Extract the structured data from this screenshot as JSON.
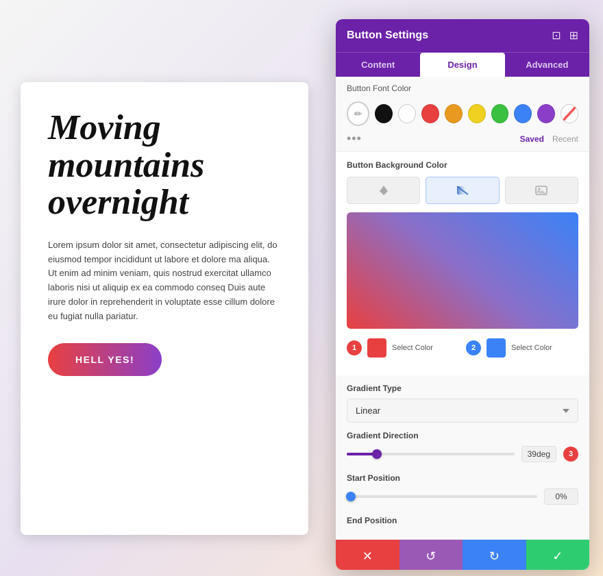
{
  "page": {
    "heading": "Moving mountains overnight",
    "body_text": "Lorem ipsum dolor sit amet, consectetur adipiscing elit, do eiusmod tempor incididunt ut labore et dolore ma aliqua. Ut enim ad minim veniam, quis nostrud exercitat ullamco laboris nisi ut aliquip ex ea commodo conseq Duis aute irure dolor in reprehenderit in voluptate esse cillum dolore eu fugiat nulla pariatur.",
    "cta_label": "HELL YES!"
  },
  "panel": {
    "title": "Button Settings",
    "tabs": [
      {
        "id": "content",
        "label": "Content"
      },
      {
        "id": "design",
        "label": "Design"
      },
      {
        "id": "advanced",
        "label": "Advanced"
      }
    ],
    "active_tab": "design",
    "font_color_label": "Button Font Color",
    "swatches": [
      "#111111",
      "#ffffff",
      "#e84040",
      "#e89a20",
      "#f0d020",
      "#3bc040",
      "#3b82f6",
      "#8b3fc8"
    ],
    "saved_label": "Saved",
    "recent_label": "Recent",
    "bg_color_label": "Button Background Color",
    "bg_types": [
      {
        "id": "solid",
        "icon": "🪣"
      },
      {
        "id": "gradient",
        "icon": "◩",
        "active": true
      },
      {
        "id": "image",
        "icon": "🖼"
      }
    ],
    "gradient": {
      "color1": "#e84040",
      "color2": "#3b82f6",
      "select_color_label": "Select Color",
      "type_label": "Gradient Type",
      "type_value": "Linear",
      "direction_label": "Gradient Direction",
      "direction_value": "39deg",
      "direction_percent": 18,
      "start_label": "Start Position",
      "start_value": "0%",
      "start_percent": 2,
      "end_label": "End Position"
    },
    "toolbar": {
      "cancel_icon": "✕",
      "reset_icon": "↺",
      "redo_icon": "↻",
      "confirm_icon": "✓"
    }
  }
}
